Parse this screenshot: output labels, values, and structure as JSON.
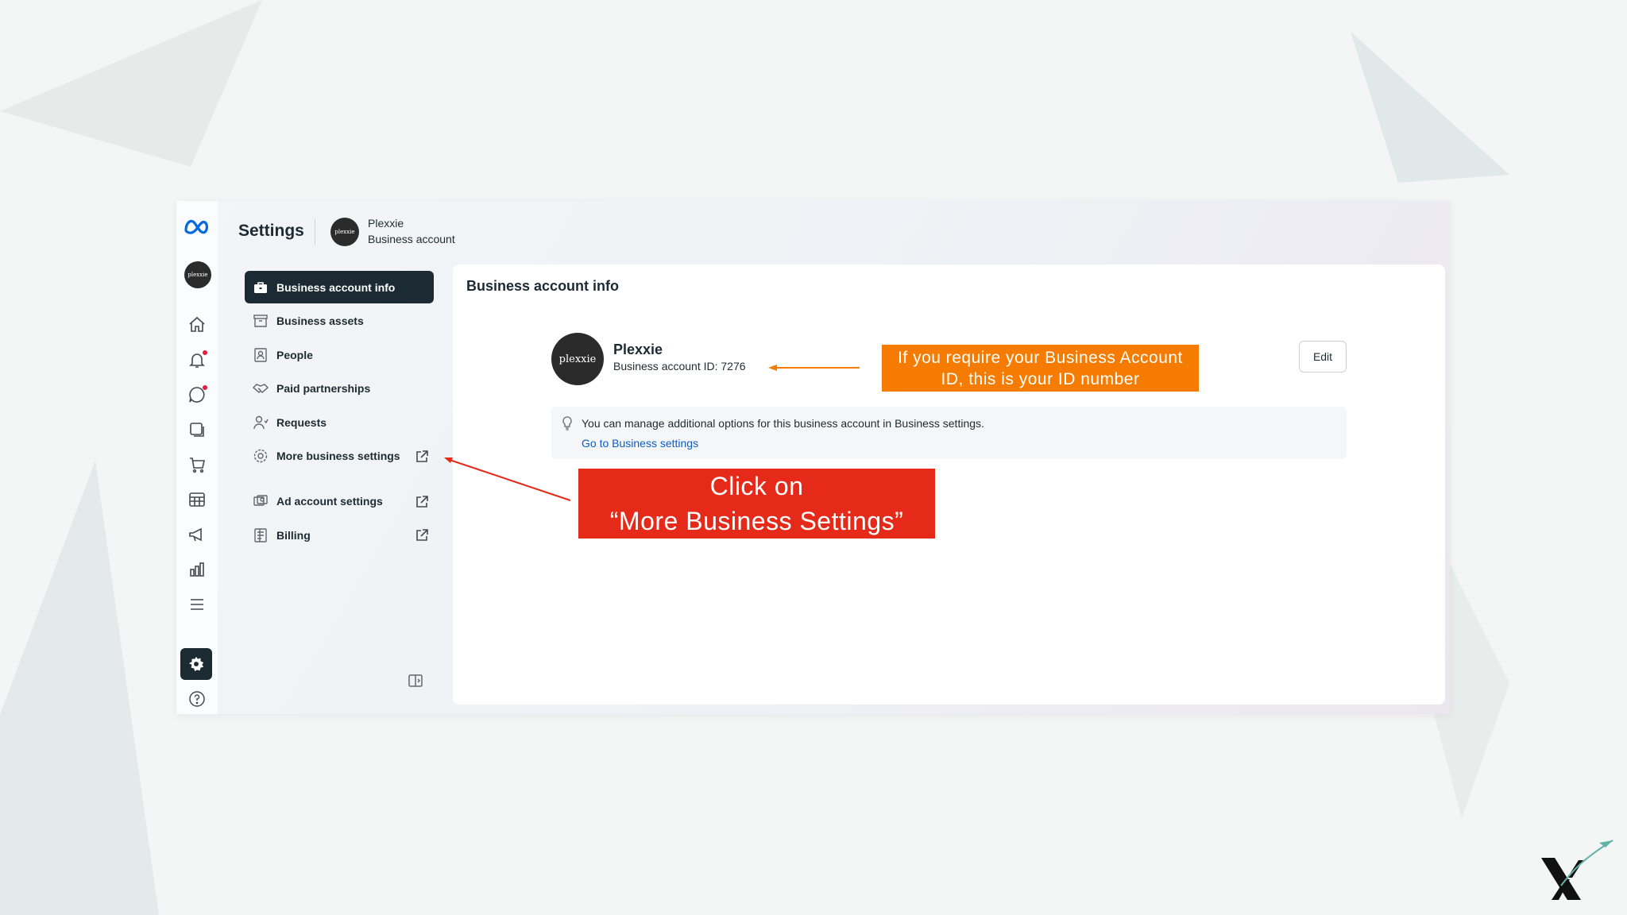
{
  "header": {
    "title": "Settings",
    "account_name": "Plexxie",
    "account_type": "Business account",
    "avatar_text": "plexxie"
  },
  "rail": {
    "avatar_text": "plexxie",
    "icons": [
      "meta-logo",
      "home-icon",
      "notifications-icon",
      "messages-icon",
      "pages-icon",
      "cart-icon",
      "table-icon",
      "megaphone-icon",
      "insights-icon",
      "menu-icon",
      "settings-icon",
      "help-icon"
    ]
  },
  "nav": {
    "items": [
      {
        "label": "Business account info",
        "icon": "briefcase-icon",
        "active": true
      },
      {
        "label": "Business assets",
        "icon": "archive-icon"
      },
      {
        "label": "People",
        "icon": "people-icon"
      },
      {
        "label": "Paid partnerships",
        "icon": "handshake-icon"
      },
      {
        "label": "Requests",
        "icon": "person-request-icon"
      },
      {
        "label": "More business settings",
        "icon": "gear-icon",
        "external": true
      },
      {
        "label": "Ad account settings",
        "icon": "ad-account-icon",
        "external": true
      },
      {
        "label": "Billing",
        "icon": "billing-icon",
        "external": true
      }
    ]
  },
  "main": {
    "title": "Business account info",
    "account_name": "Plexxie",
    "account_id": "Business account ID: 7276",
    "avatar_text": "plexxie",
    "edit_label": "Edit",
    "info_text": "You can manage additional options for this business account in Business settings.",
    "info_link": "Go to Business settings"
  },
  "annotations": {
    "orange_callout": "If you require your Business Account\nID, this is your  ID number",
    "red_callout_line1": "Click on",
    "red_callout_line2": "“More Business Settings”",
    "orange": "#f57c00",
    "red": "#e52a19"
  },
  "colors": {
    "nav_active_bg": "#1c2b33",
    "link": "#0a5dc2",
    "meta_blue": "#0668E1"
  }
}
